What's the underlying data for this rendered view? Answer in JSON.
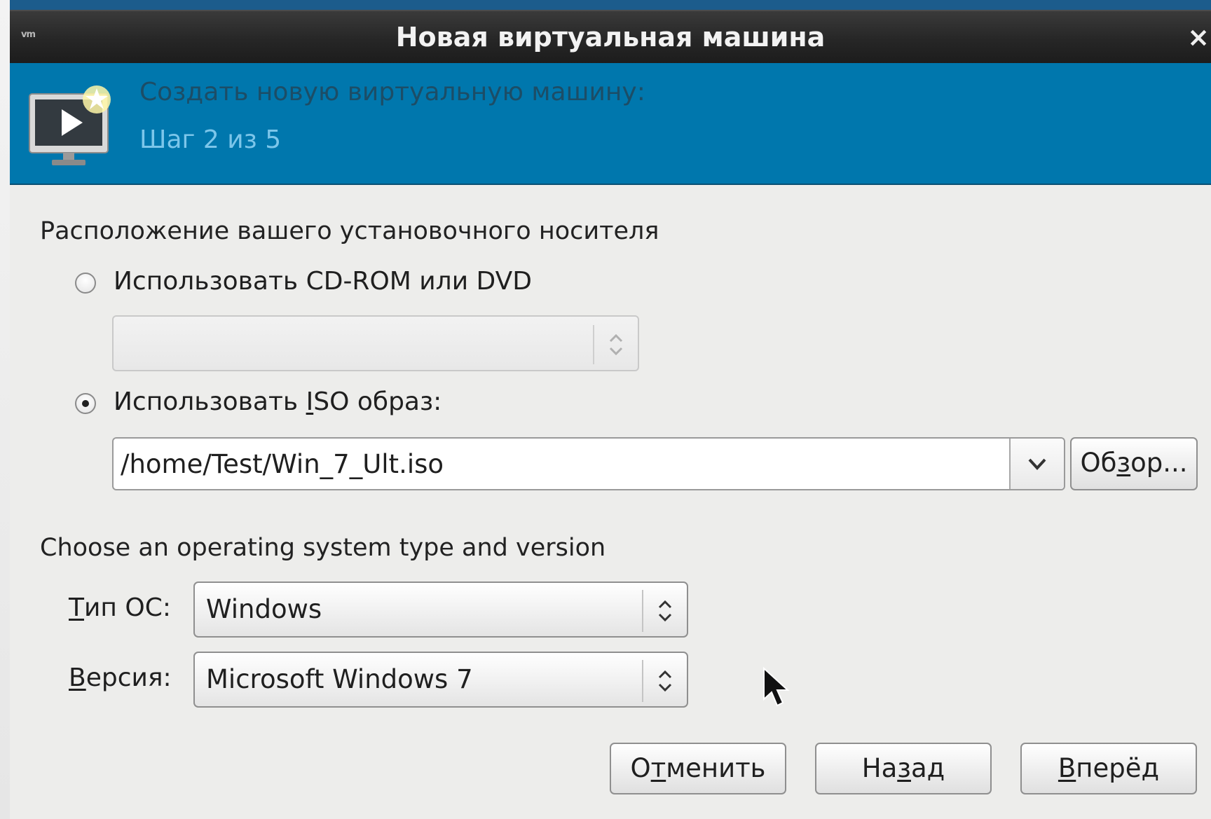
{
  "window": {
    "title": "Новая виртуальная машина",
    "logo": "vm",
    "close_glyph": "×"
  },
  "banner": {
    "icon": "monitor-play-star-icon",
    "title": "Создать новую виртуальную машину:",
    "step": "Шаг 2 из 5",
    "background": "#0077ad"
  },
  "install_media": {
    "heading": "Расположение вашего установочного носителя",
    "cdrom": {
      "label": "Использовать CD-ROM или DVD",
      "selected": false,
      "device_value": ""
    },
    "iso": {
      "label_pre": "Использовать ",
      "label_mnemonic": "I",
      "label_post": "SO образ:",
      "selected": true,
      "path": "/home/Test/Win_7_Ult.iso",
      "browse_pre": "Об",
      "browse_mnemonic": "з",
      "browse_post": "ор..."
    }
  },
  "os": {
    "heading": "Choose an operating system type and version",
    "type_label_mnemonic": "Т",
    "type_label_rest": "ип ОС:",
    "type_value": "Windows",
    "version_label_mnemonic": "В",
    "version_label_rest": "ерсия:",
    "version_value": "Microsoft Windows 7"
  },
  "buttons": {
    "cancel_pre": "О",
    "cancel_mnemonic": "т",
    "cancel_post": "менить",
    "back_pre": "На",
    "back_mnemonic": "з",
    "back_post": "ад",
    "forward_mnemonic": "В",
    "forward_post": "перёд"
  }
}
